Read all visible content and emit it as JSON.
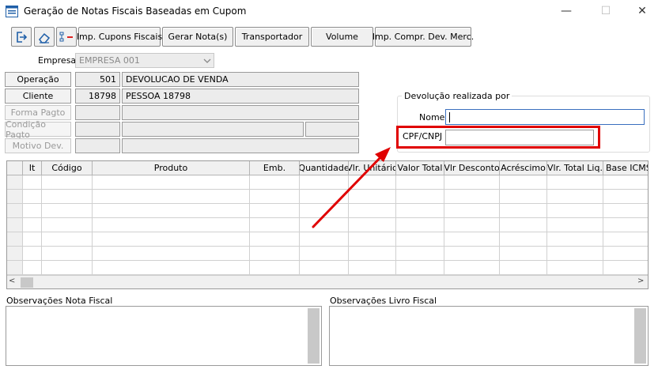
{
  "window": {
    "title": "Geração de Notas Fiscais Baseadas em Cupom"
  },
  "toolbar": {
    "icons": [
      "exit-icon",
      "eraser-icon",
      "list-remove-icon"
    ],
    "buttons": [
      "Imp. Cupons Fiscais",
      "Gerar Nota(s)",
      "Transportador",
      "Volume",
      "Imp. Compr. Dev. Merc."
    ]
  },
  "form": {
    "empresa_label": "Empresa",
    "empresa_value": "EMPRESA 001",
    "operacao_label": "Operação",
    "operacao_code": "501",
    "operacao_desc": "DEVOLUCAO DE VENDA",
    "cliente_label": "Cliente",
    "cliente_code": "18798",
    "cliente_desc": "PESSOA 18798",
    "forma_pagto_label": "Forma Pagto",
    "condicao_pagto_label": "Condição Pagto",
    "motivo_dev_label": "Motivo Dev."
  },
  "devolucao": {
    "group_title": "Devolução realizada por",
    "nome_label": "Nome",
    "nome_value": "",
    "cpf_label": "CPF/CNPJ",
    "cpf_value": "",
    "highlight_color": "#e00000"
  },
  "grid": {
    "columns": [
      "It",
      "Código",
      "Produto",
      "Emb.",
      "Quantidade",
      "Vlr. Unitário",
      "Valor Total",
      "Vlr Desconto",
      "Acréscimo",
      "Vlr. Total Liq.",
      "Base ICMS"
    ]
  },
  "notes": {
    "nota_fiscal_label": "Observações Nota Fiscal",
    "livro_fiscal_label": "Observações Livro Fiscal"
  }
}
